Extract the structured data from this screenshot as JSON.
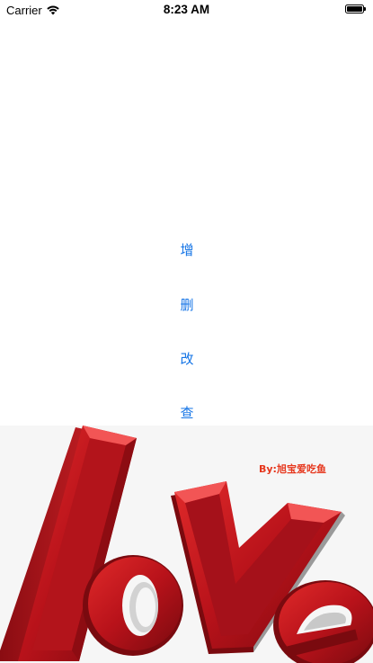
{
  "status_bar": {
    "carrier": "Carrier",
    "time": "8:23 AM",
    "battery_level": 1.0
  },
  "actions": [
    {
      "label": "增"
    },
    {
      "label": "删"
    },
    {
      "label": "改"
    },
    {
      "label": "查"
    }
  ],
  "image": {
    "credit": "By:旭宝爱吃鱼",
    "word": "love",
    "word_color": "#c8161d"
  }
}
